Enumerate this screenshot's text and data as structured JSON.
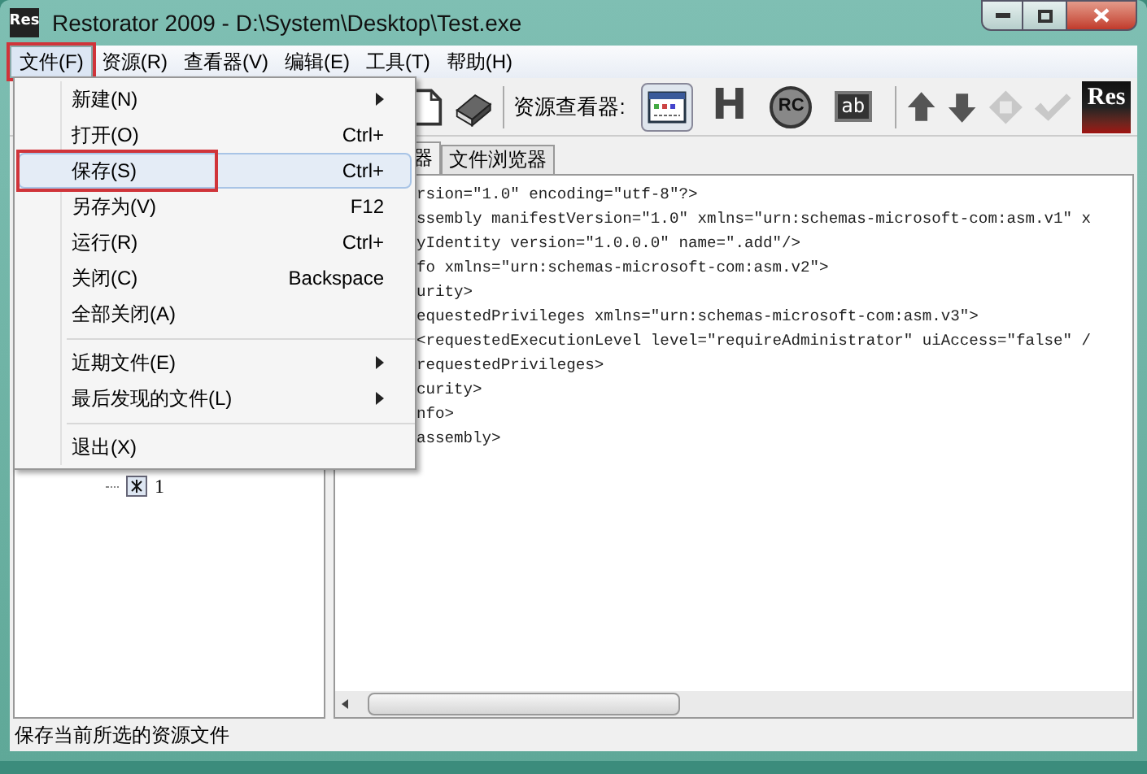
{
  "window": {
    "app_icon_text": "Res",
    "title": "Restorator 2009 - D:\\System\\Desktop\\Test.exe"
  },
  "menubar": [
    {
      "label": "文件(F)",
      "selected": true,
      "annotated": true
    },
    {
      "label": "资源(R)",
      "selected": false,
      "annotated": false
    },
    {
      "label": "查看器(V)",
      "selected": false,
      "annotated": false
    },
    {
      "label": "编辑(E)",
      "selected": false,
      "annotated": false
    },
    {
      "label": "工具(T)",
      "selected": false,
      "annotated": false
    },
    {
      "label": "帮助(H)",
      "selected": false,
      "annotated": false
    }
  ],
  "file_menu": [
    {
      "kind": "item",
      "label": "新建(N)",
      "submenu": true,
      "selected": false,
      "annotated": false
    },
    {
      "kind": "item",
      "label": "打开(O)",
      "shortcut": "Ctrl+",
      "selected": false,
      "annotated": false
    },
    {
      "kind": "item",
      "label": "保存(S)",
      "shortcut": "Ctrl+",
      "selected": true,
      "annotated": true
    },
    {
      "kind": "item",
      "label": "另存为(V)",
      "shortcut": "F12",
      "selected": false,
      "annotated": false
    },
    {
      "kind": "item",
      "label": "运行(R)",
      "shortcut": "Ctrl+",
      "selected": false,
      "annotated": false
    },
    {
      "kind": "item",
      "label": "关闭(C)",
      "shortcut": "Backspace",
      "selected": false,
      "annotated": false
    },
    {
      "kind": "item",
      "label": "全部关闭(A)",
      "selected": false,
      "annotated": false
    },
    {
      "kind": "separator"
    },
    {
      "kind": "item",
      "label": "近期文件(E)",
      "submenu": true,
      "selected": false,
      "annotated": false
    },
    {
      "kind": "item",
      "label": "最后发现的文件(L)",
      "submenu": true,
      "selected": false,
      "annotated": false
    },
    {
      "kind": "separator"
    },
    {
      "kind": "item",
      "label": "退出(X)",
      "selected": false,
      "annotated": false
    }
  ],
  "toolbar": {
    "file_buttons": [
      {
        "kind": "new"
      },
      {
        "kind": "help"
      }
    ],
    "viewer_label": "资源查看器:",
    "viewer_buttons": [
      {
        "kind": "dialog",
        "selected": true
      },
      {
        "kind": "header",
        "label": "H",
        "selected": false
      },
      {
        "kind": "rc",
        "label": "RC",
        "selected": false
      },
      {
        "kind": "string",
        "label": "ab",
        "selected": false
      }
    ],
    "nav_buttons": [
      {
        "kind": "up",
        "disabled": false
      },
      {
        "kind": "down",
        "disabled": false
      },
      {
        "kind": "diamond",
        "disabled": true
      },
      {
        "kind": "check",
        "disabled": true
      }
    ],
    "logo": "Res"
  },
  "tree": {
    "items": [
      {
        "label": "1"
      }
    ]
  },
  "tabs": [
    {
      "label": "器",
      "selected": true
    },
    {
      "label": "文件浏览器",
      "selected": false
    }
  ],
  "code_lines": [
    "rsion=\"1.0\" encoding=\"utf-8\"?>",
    "ssembly manifestVersion=\"1.0\" xmlns=\"urn:schemas-microsoft-com:asm.v1\" x",
    "yIdentity version=\"1.0.0.0\" name=\".add\"/>",
    "fo xmlns=\"urn:schemas-microsoft-com:asm.v2\">",
    "urity>",
    "equestedPrivileges xmlns=\"urn:schemas-microsoft-com:asm.v3\">",
    "<requestedExecutionLevel level=\"requireAdministrator\" uiAccess=\"false\" /",
    "requestedPrivileges>",
    "curity>",
    "nfo>",
    "assembly>"
  ],
  "status_bar": "保存当前所选的资源文件"
}
